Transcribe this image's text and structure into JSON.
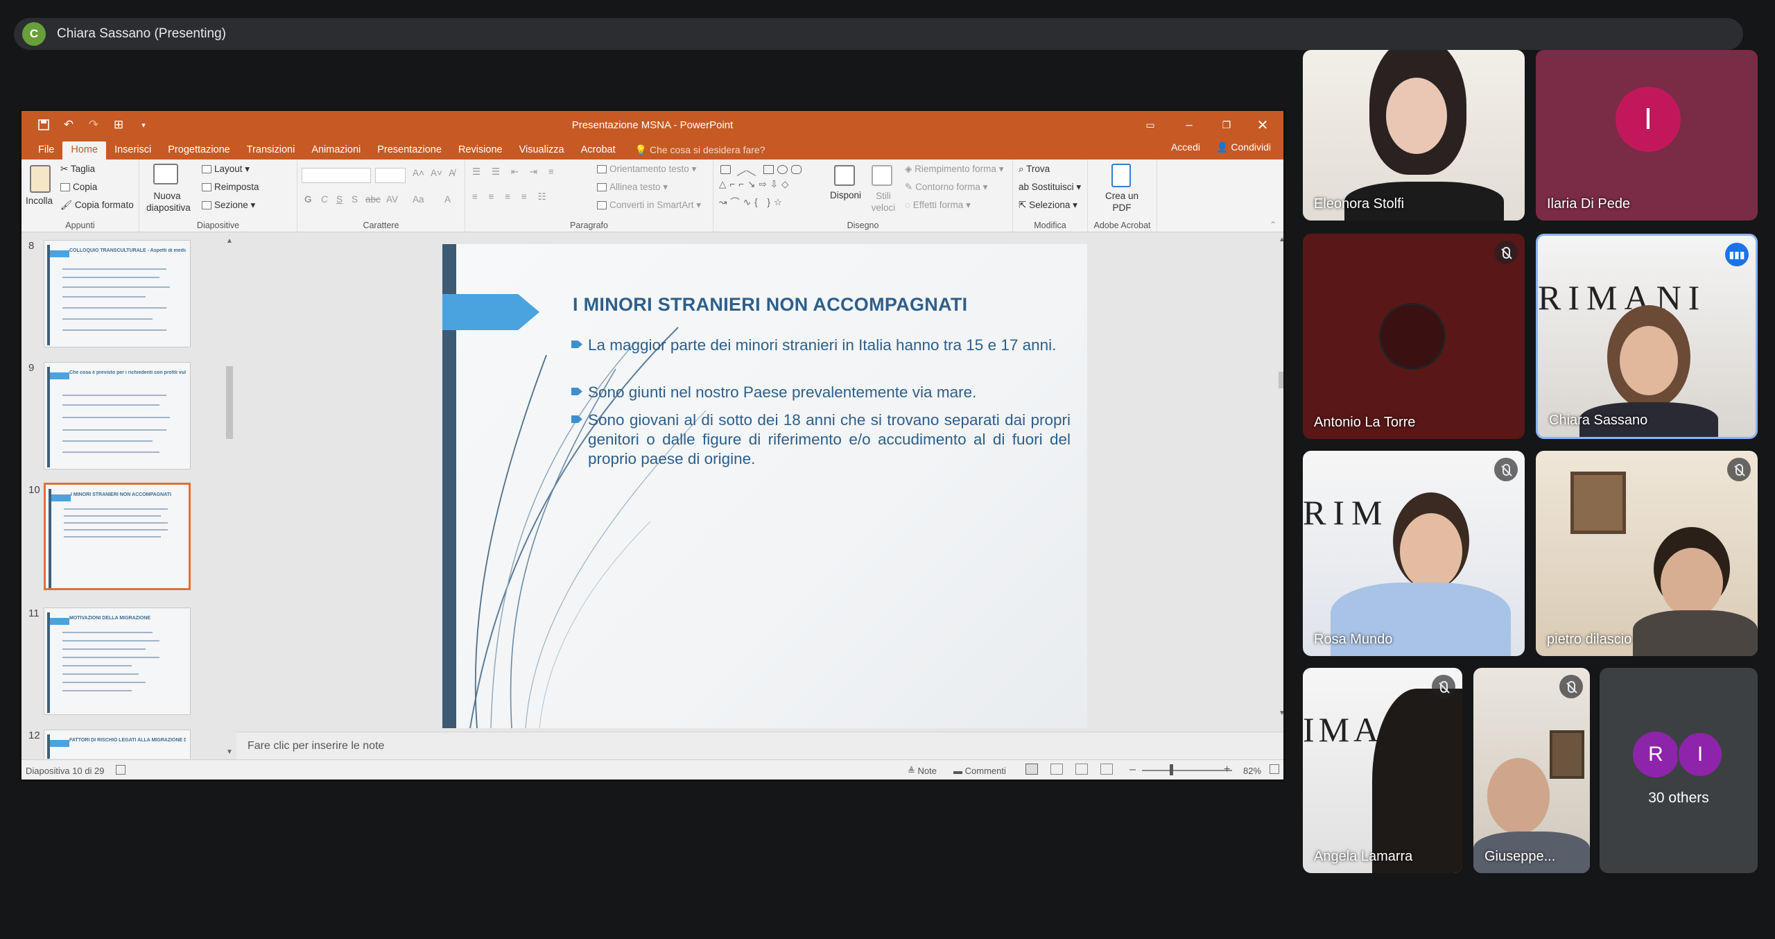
{
  "meet": {
    "presenter_initial": "C",
    "presenting_label": "Chiara Sassano (Presenting)"
  },
  "powerpoint": {
    "title": "Presentazione MSNA - PowerPoint",
    "tabs": [
      "File",
      "Home",
      "Inserisci",
      "Progettazione",
      "Transizioni",
      "Animazioni",
      "Presentazione",
      "Revisione",
      "Visualizza",
      "Acrobat"
    ],
    "active_tab": "Home",
    "tell_me": "Che cosa si desidera fare?",
    "accedi": "Accedi",
    "condividi": "Condividi",
    "ribbon": {
      "appunti": {
        "label": "Appunti",
        "incolla": "Incolla",
        "taglia": "Taglia",
        "copia": "Copia",
        "copia_formato": "Copia formato"
      },
      "diapositive": {
        "label": "Diapositive",
        "nuova": "Nuova diapositiva",
        "layout": "Layout",
        "reimposta": "Reimposta",
        "sezione": "Sezione"
      },
      "carattere": {
        "label": "Carattere",
        "bold": "G",
        "italic": "C",
        "underline": "S",
        "shadow": "S",
        "strike": "abc",
        "spacing": "AV",
        "case": "Aa",
        "color": "A"
      },
      "paragrafo": {
        "label": "Paragrafo",
        "orientamento": "Orientamento testo",
        "allinea": "Allinea testo",
        "converti": "Converti in SmartArt"
      },
      "disegno": {
        "label": "Disegno",
        "disponi": "Disponi",
        "stili": "Stili veloci",
        "riempimento": "Riempimento forma",
        "contorno": "Contorno forma",
        "effetti": "Effetti forma"
      },
      "modifica": {
        "label": "Modifica",
        "trova": "Trova",
        "sostituisci": "Sostituisci",
        "seleziona": "Seleziona"
      },
      "acrobat": {
        "label": "Adobe Acrobat",
        "crea": "Crea un PDF"
      }
    },
    "thumbnails": [
      {
        "num": "8",
        "title": "COLLOQUIO TRANSCULTURALE - Aspetti di mediazione"
      },
      {
        "num": "9",
        "title": "Che cosa è previsto per i richiedenti con profili vulnerabili?"
      },
      {
        "num": "10",
        "title": "I MINORI STRANIERI NON ACCOMPAGNATI"
      },
      {
        "num": "11",
        "title": "MOTIVAZIONI DELLA MIGRAZIONE"
      },
      {
        "num": "12",
        "title": "FATTORI DI RISCHIO LEGATI ALLA MIGRAZIONE DEI MSNA"
      }
    ],
    "slide": {
      "title": "I MINORI STRANIERI NON ACCOMPAGNATI",
      "bullets": [
        "La maggior parte dei minori stranieri in Italia hanno tra 15 e 17 anni.",
        "Sono giunti nel nostro Paese prevalentemente via mare.",
        "Sono giovani al di sotto dei 18 anni che si trovano separati dai propri genitori o dalle figure di riferimento e/o accudimento al di fuori del proprio paese di origine."
      ]
    },
    "notes_placeholder": "Fare clic per inserire le note",
    "status": {
      "slide_counter": "Diapositiva 10 di 29",
      "note": "Note",
      "commenti": "Commenti",
      "zoom": "82%"
    }
  },
  "participants": [
    {
      "name": "Eleonora Stolfi",
      "muted": false
    },
    {
      "name": "Ilaria Di Pede",
      "initial": "I",
      "avatar_color": "#c2185b",
      "muted": false
    },
    {
      "name": "Antonio La Torre",
      "muted": true
    },
    {
      "name": "Chiara Sassano",
      "muted": false
    },
    {
      "name": "Rosa Mundo",
      "muted": true
    },
    {
      "name": "pietro dilascio",
      "muted": true
    },
    {
      "name": "Angela Lamarra",
      "muted": true
    },
    {
      "name": "Giuseppe...",
      "muted": true
    }
  ],
  "others": {
    "initials": [
      "R",
      "I"
    ],
    "label": "30 others",
    "avatar_color": "#8e24aa"
  }
}
